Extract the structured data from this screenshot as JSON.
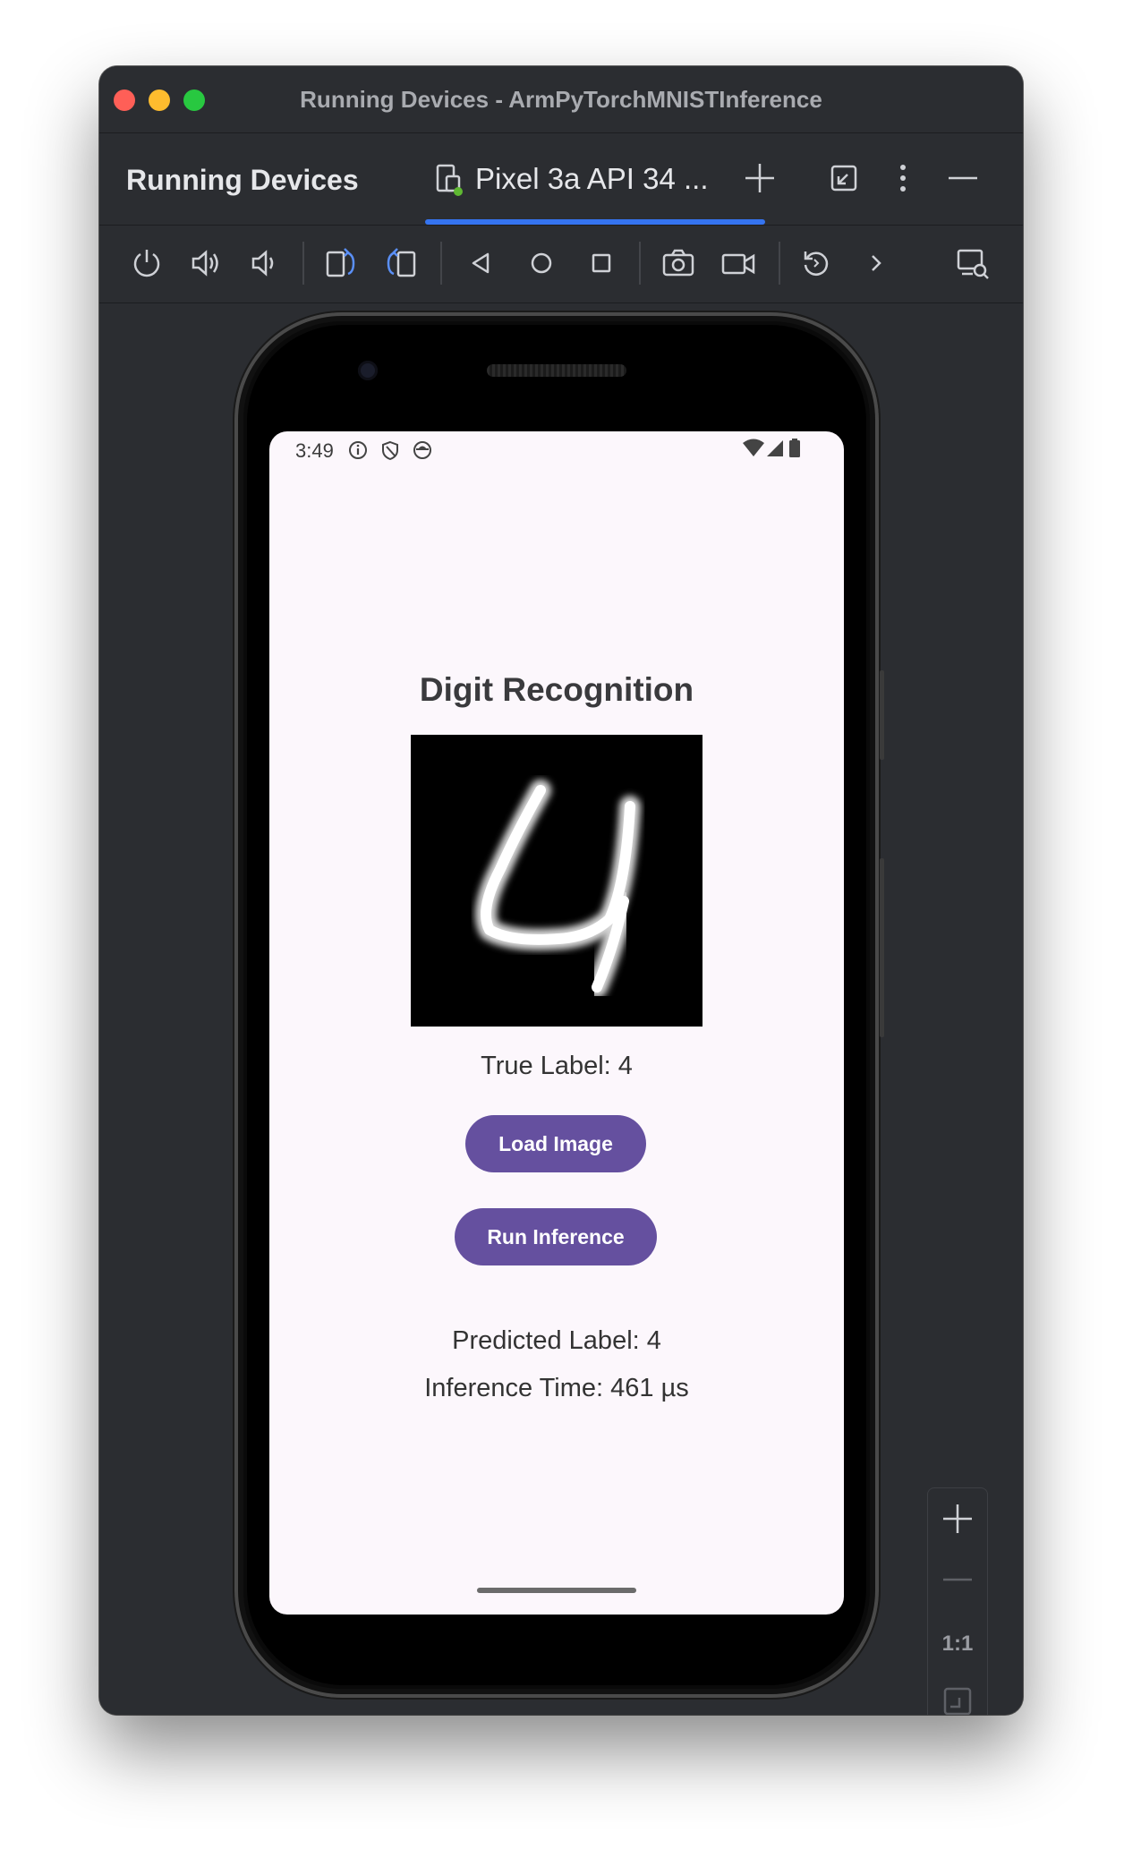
{
  "window": {
    "title": "Running Devices - ArmPyTorchMNISTInference"
  },
  "tabbar": {
    "panel_title": "Running Devices",
    "device_tab_label": "Pixel 3a API 34 ..."
  },
  "toolbar": {
    "icons": [
      "power-icon",
      "volume-up-icon",
      "volume-down-icon",
      "rotate-left-icon",
      "rotate-right-icon",
      "back-icon",
      "home-icon",
      "overview-icon",
      "screenshot-icon",
      "screen-record-icon",
      "reset-icon",
      "more-chevron-icon",
      "device-mirroring-icon"
    ]
  },
  "phone": {
    "status": {
      "time": "3:49"
    },
    "app": {
      "title": "Digit Recognition",
      "true_label": "True Label: 4",
      "load_button": "Load Image",
      "run_button": "Run Inference",
      "predicted_label": "Predicted Label: 4",
      "inference_time": "Inference Time: 461 µs"
    }
  },
  "zoom_controls": {
    "one_to_one": "1:1"
  },
  "colors": {
    "accent": "#3574f0",
    "button": "#65509f",
    "screen_bg": "#fcf7fc",
    "ide_bg": "#2b2d31"
  }
}
